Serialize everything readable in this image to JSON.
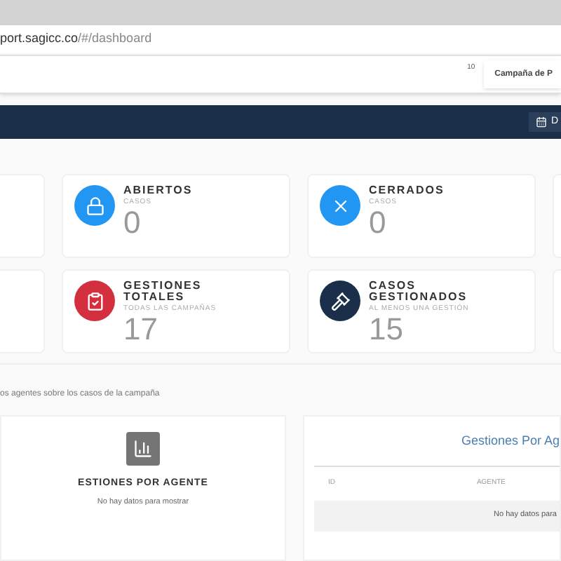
{
  "browser": {
    "url_host": "port.sagicc.co",
    "url_path": "/#/dashboard"
  },
  "toolbar": {
    "count": "10",
    "campaign": "Campaña de P"
  },
  "navbar": {
    "button_label": "D"
  },
  "stats": [
    {
      "color": "#2196f3",
      "title": [
        "ABIERTOS"
      ],
      "subtitle": "CASOS",
      "value": "0"
    },
    {
      "color": "#2196f3",
      "title": [
        "CERRADOS"
      ],
      "subtitle": "CASOS",
      "value": "0"
    },
    {
      "color": "#d32f3f",
      "title": [
        "GESTIONES",
        "TOTALES"
      ],
      "subtitle": "TODAS LAS CAMPAÑAS",
      "value": "17"
    },
    {
      "color": "#1c2f4a",
      "title": [
        "CASOS",
        "GESTIONADOS"
      ],
      "subtitle": "AL MENOS UNA GESTIÓN",
      "value": "15"
    }
  ],
  "section_caption": "os agentes sobre los casos de la campaña",
  "chart_panel": {
    "title": "ESTIONES POR AGENTE",
    "empty": "No hay datos para mostrar"
  },
  "table_panel": {
    "title": "Gestiones Por Ag",
    "columns": [
      "ID",
      "AGENTE"
    ],
    "empty": "No hay datos para"
  }
}
